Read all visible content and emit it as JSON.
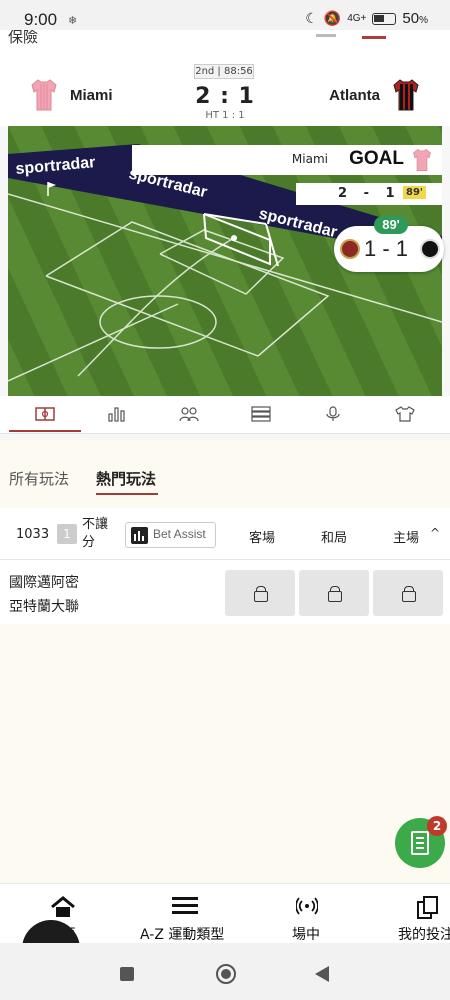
{
  "status_bar": {
    "time": "9:00",
    "battery_pct": "50",
    "battery_unit": "%",
    "network": "4G+"
  },
  "header": {
    "cut_title": "保險"
  },
  "match": {
    "period": "2nd | 88:56",
    "home_team": "Miami",
    "away_team": "Atlanta",
    "score": "2 : 1",
    "halftime": "HT 1 : 1"
  },
  "tracker": {
    "sponsor_text": "sportradar",
    "goal_team": "Miami",
    "goal_label": "GOAL",
    "banner_score": "2 - 1",
    "banner_minute": "89'",
    "live_minute": "89'",
    "live_score": "1 - 1"
  },
  "icon_tabs": [
    {
      "name": "pitch-icon"
    },
    {
      "name": "stats-icon"
    },
    {
      "name": "lineup-icon"
    },
    {
      "name": "table-icon"
    },
    {
      "name": "commentary-icon"
    },
    {
      "name": "jersey-icon"
    }
  ],
  "bet_tabs": {
    "all": "所有玩法",
    "hot": "熱門玩法"
  },
  "market": {
    "id": "1033",
    "count": "1",
    "name": "不讓分",
    "bet_assist": "Bet Assist",
    "col_away": "客場",
    "col_draw": "和局",
    "col_home": "主場"
  },
  "match_row": {
    "team1": "國際邁阿密",
    "team2": "亞特蘭大聯"
  },
  "betslip": {
    "count": "2"
  },
  "bottom_nav": {
    "home": "首頁",
    "az": "A-Z 運動類型",
    "live": "場中",
    "mybets": "我的投注"
  },
  "colors": {
    "accent": "#a33a3a",
    "betslip": "#3daa4a",
    "pitch": "#4c7d2e"
  }
}
